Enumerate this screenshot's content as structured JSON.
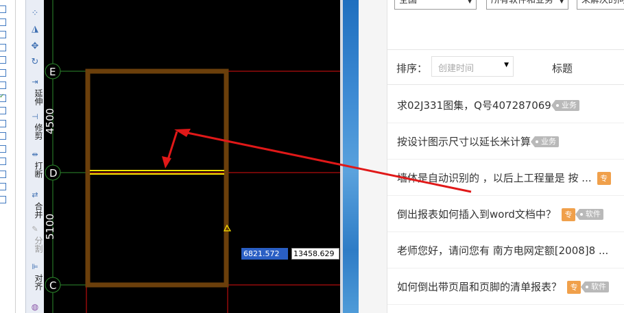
{
  "left_strip": {
    "checkboxes": [
      false,
      false,
      false,
      false,
      false,
      false,
      false,
      true,
      false,
      false,
      false,
      false,
      false,
      false,
      false,
      false
    ]
  },
  "toolbar": {
    "extend_label": "延伸",
    "trim_label": "修剪",
    "break_label": "打断",
    "merge_label": "合并",
    "split_label": "分割",
    "align_label": "对齐"
  },
  "cad": {
    "axes": [
      {
        "label": "E"
      },
      {
        "label": "D"
      },
      {
        "label": "C"
      }
    ],
    "dimensions": [
      {
        "value": "4500"
      },
      {
        "value": "5100"
      }
    ],
    "coord_x": "6821.572",
    "coord_y": "13458.629",
    "colors": {
      "wall": "#6b3f0b",
      "axis_line": "#e01010",
      "grid_line": "#2e8b2e",
      "selected_beam": "#ffe600",
      "background": "#000000"
    }
  },
  "panel": {
    "filters": [
      {
        "label": "全国"
      },
      {
        "label": "所有软件和业务"
      },
      {
        "label": "未解决的问题"
      }
    ],
    "sort_label": "排序：",
    "sort_select": "创建时间",
    "sort_title": "标题",
    "questions": [
      {
        "text": "求02J331图集，Q号407287069",
        "tags": [
          {
            "type": "grey",
            "label": "业务"
          }
        ]
      },
      {
        "text": "按设计图示尺寸以延长米计算",
        "tags": [
          {
            "type": "grey",
            "label": "业务"
          }
        ]
      },
      {
        "text": "墙体是自动识别的 ，以后上工程量是 按 ...",
        "tags": [
          {
            "type": "orange",
            "label": "专"
          }
        ]
      },
      {
        "text": "倒出报表如何插入到word文档中？",
        "tags": [
          {
            "type": "orange",
            "label": "专"
          },
          {
            "type": "grey",
            "label": "软件"
          }
        ]
      },
      {
        "text": "老师您好，请问您有 南方电网定额[2008]8 ...",
        "tags": []
      },
      {
        "text": "如何倒出带页眉和页脚的清单报表？",
        "tags": [
          {
            "type": "orange",
            "label": "专"
          },
          {
            "type": "grey",
            "label": "软件"
          }
        ]
      }
    ]
  },
  "annotation": {
    "arrow_color": "#e01818"
  }
}
